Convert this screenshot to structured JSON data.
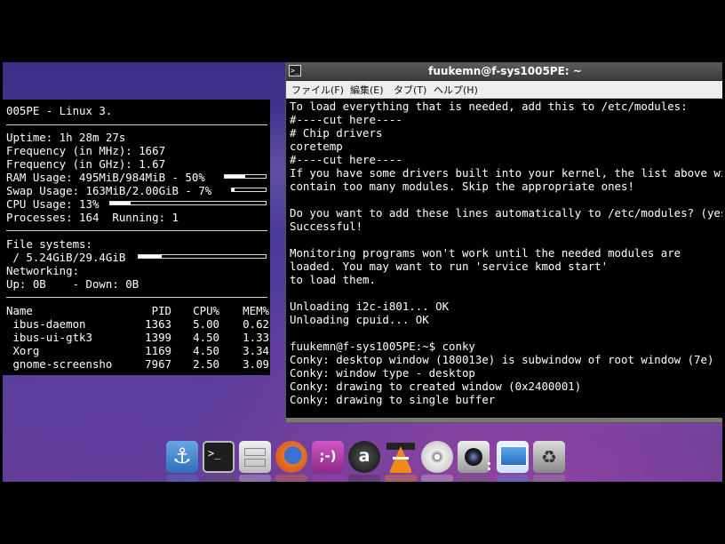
{
  "conky": {
    "title": "005PE - Linux 3.",
    "uptime": "Uptime: 1h 28m 27s",
    "freq_mhz": "Frequency (in MHz): 1667",
    "freq_ghz": "Frequency (in GHz): 1.67",
    "ram": "RAM Usage: 495MiB/984MiB - 50%",
    "ram_pct": 50,
    "swap": "Swap Usage: 163MiB/2.00GiB - 7%",
    "swap_pct": 7,
    "cpu": "CPU Usage: 13%",
    "cpu_pct": 13,
    "processes": "Processes: 164  Running: 1",
    "fs_label": "File systems:",
    "fs_usage": " / 5.24GiB/29.4GiB",
    "fs_pct": 18,
    "net_label": "Networking:",
    "net_line": "Up: 0B    - Down: 0B",
    "proc_headers": {
      "name": "Name",
      "pid": "PID",
      "cpu": "CPU%",
      "mem": "MEM%"
    },
    "procs": [
      {
        "name": " ibus-daemon",
        "pid": "1363",
        "cpu": "5.00",
        "mem": "0.62"
      },
      {
        "name": " ibus-ui-gtk3",
        "pid": "1399",
        "cpu": "4.50",
        "mem": "1.33"
      },
      {
        "name": " Xorg",
        "pid": "1169",
        "cpu": "4.50",
        "mem": "3.34"
      },
      {
        "name": " gnome-screensho",
        "pid": "7967",
        "cpu": "2.50",
        "mem": "3.09"
      }
    ]
  },
  "terminal": {
    "title": "fuukemn@f-sys1005PE: ~",
    "menu": [
      "ファイル(F)",
      "編集(E)",
      "タブ(T)",
      "ヘルプ(H)"
    ],
    "lines": [
      "To load everything that is needed, add this to /etc/modules:",
      "#----cut here----",
      "# Chip drivers",
      "coretemp",
      "#----cut here----",
      "If you have some drivers built into your kernel, the list above will",
      "contain too many modules. Skip the appropriate ones!",
      "",
      "Do you want to add these lines automatically to /etc/modules? (yes/NO)",
      "Successful!",
      "",
      "Monitoring programs won't work until the needed modules are",
      "loaded. You may want to run 'service kmod start'",
      "to load them.",
      "",
      "Unloading i2c-i801... OK",
      "Unloading cpuid... OK",
      "",
      "fuukemn@f-sys1005PE:~$ conky",
      "Conky: desktop window (180013e) is subwindow of root window (7e)",
      "Conky: window type - desktop",
      "Conky: drawing to created window (0x2400001)",
      "Conky: drawing to single buffer"
    ]
  },
  "dock": {
    "items": [
      {
        "icon": "anchor-icon",
        "color": "#4a86c8"
      },
      {
        "icon": "terminal-icon",
        "color": "#2b2b2b"
      },
      {
        "icon": "file-cabinet-icon",
        "color": "#d8d8d8"
      },
      {
        "icon": "firefox-icon",
        "color": "#e8742a"
      },
      {
        "icon": "chat-icon",
        "color": "#b03aa6"
      },
      {
        "icon": "amazon-icon",
        "color": "#333333"
      },
      {
        "icon": "vlc-icon",
        "color": "#f08a1a"
      },
      {
        "icon": "disc-icon",
        "color": "#cfcfcf"
      },
      {
        "icon": "webcam-icon",
        "color": "#444444"
      },
      {
        "icon": "monitor-icon",
        "color": "#3d8fd6"
      },
      {
        "icon": "trash-icon",
        "color": "#9a9a9a"
      }
    ]
  }
}
